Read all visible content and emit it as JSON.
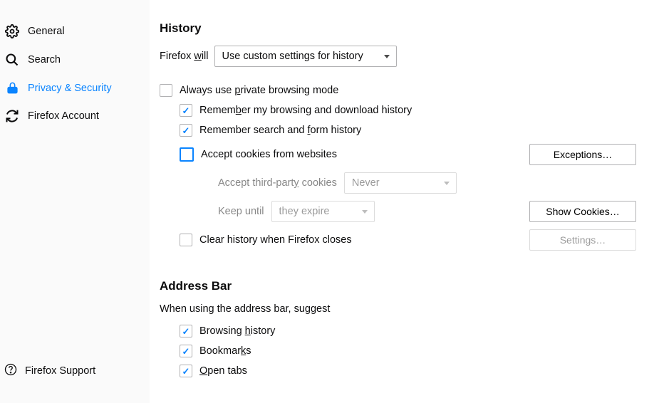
{
  "sidebar": {
    "items": [
      {
        "label": "General"
      },
      {
        "label": "Search"
      },
      {
        "label": "Privacy & Security"
      },
      {
        "label": "Firefox Account"
      }
    ],
    "support": "Firefox Support"
  },
  "history": {
    "title": "History",
    "will_prefix": "Firefox ",
    "will_u": "w",
    "will_suffix": "ill",
    "mode_selected": "Use custom settings for history",
    "private_prefix": "Always use ",
    "private_u": "p",
    "private_suffix": "rivate browsing mode",
    "remember_browsing_prefix": "Remem",
    "remember_browsing_u": "b",
    "remember_browsing_suffix": "er my browsing and download history",
    "remember_form_prefix": "Remember search and ",
    "remember_form_u": "f",
    "remember_form_suffix": "orm history",
    "accept_cookies_u": "A",
    "accept_cookies_suffix": "ccept cookies from websites",
    "exceptions_u": "E",
    "exceptions_suffix": "xceptions…",
    "third_party_prefix": "Accept third-part",
    "third_party_u": "y",
    "third_party_suffix": " cookies",
    "third_party_value": "Never",
    "keep_prefix": "Keep ",
    "keep_u": "u",
    "keep_suffix": "ntil",
    "keep_value": "they expire",
    "show_cookies_u": "S",
    "show_cookies_suffix": "how Cookies…",
    "clear_history_prefix": "Clea",
    "clear_history_u": "r",
    "clear_history_suffix": " history when Firefox closes",
    "settings_prefix": "Se",
    "settings_u": "t",
    "settings_suffix": "tings…"
  },
  "addressbar": {
    "title": "Address Bar",
    "hint": "When using the address bar, suggest",
    "browsing_prefix": "Browsing ",
    "browsing_u": "h",
    "browsing_suffix": "istory",
    "bookmarks_prefix": "Bookmar",
    "bookmarks_u": "k",
    "bookmarks_suffix": "s",
    "opentabs_u": "O",
    "opentabs_suffix": "pen tabs"
  }
}
